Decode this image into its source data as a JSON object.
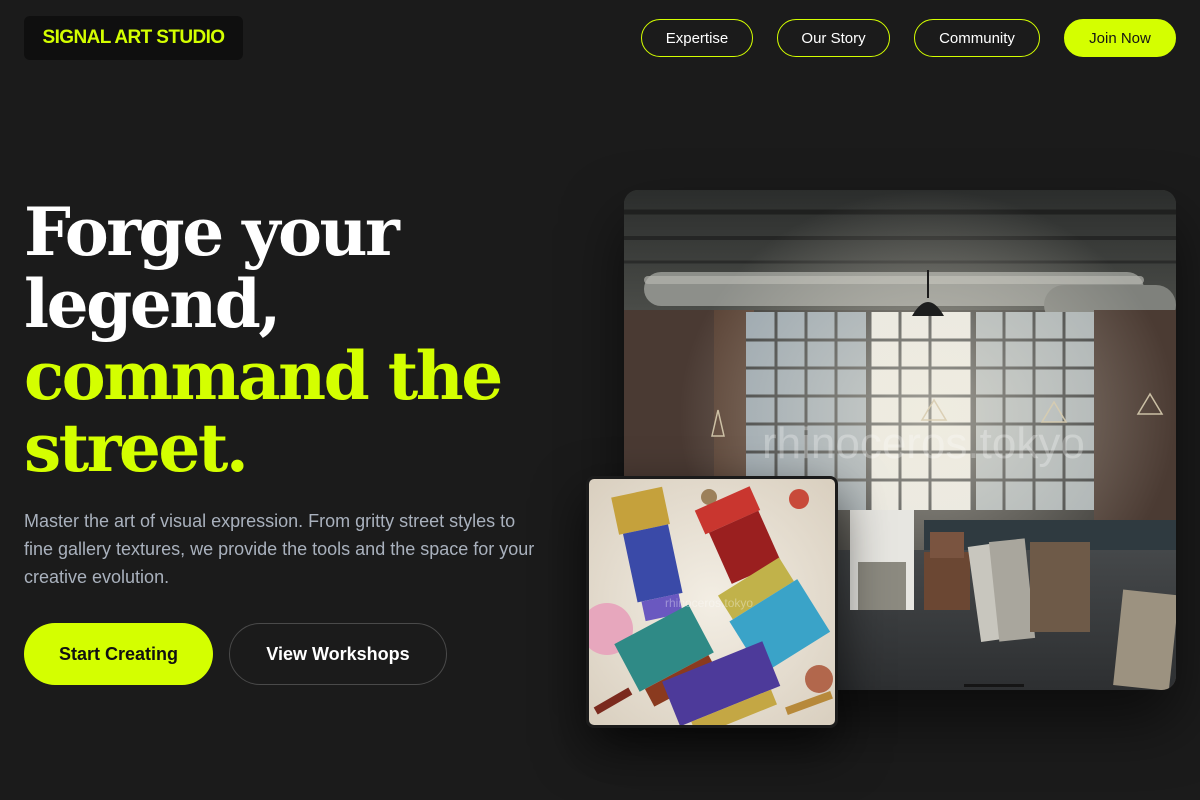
{
  "header": {
    "logo_text": "SIGNAL ART STUDIO",
    "nav": [
      {
        "label": "Expertise"
      },
      {
        "label": "Our Story"
      },
      {
        "label": "Community"
      }
    ],
    "join_label": "Join Now"
  },
  "hero": {
    "headline_lines": [
      "Forge your",
      "legend,",
      "command the",
      "street."
    ],
    "subtext": "Master the art of visual expression. From gritty street styles to fine gallery textures, we provide the tools and the space for your creative evolution.",
    "primary_cta": "Start Creating",
    "secondary_cta": "View Workshops"
  },
  "images": {
    "studio_watermark": "rhinoceros.tokyo",
    "brushes_watermark": "rhinoceros.tokyo"
  },
  "colors": {
    "accent": "#d4ff00",
    "background": "#1b1b1b",
    "text_muted": "#a9b1bd"
  }
}
